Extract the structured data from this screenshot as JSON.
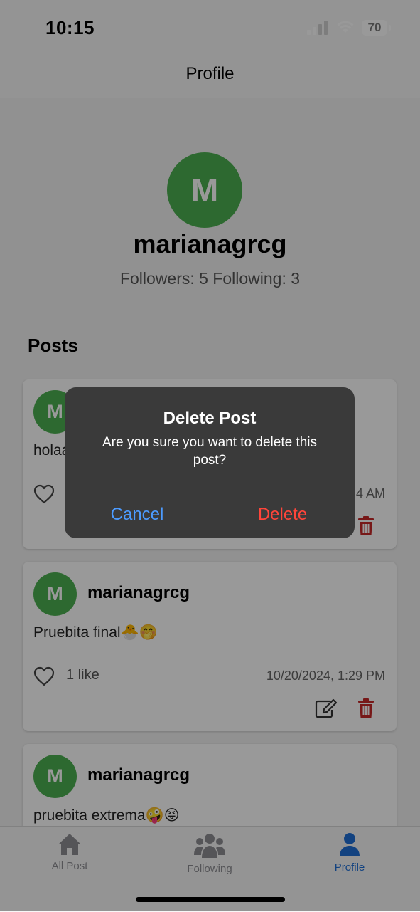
{
  "status_bar": {
    "time": "10:15",
    "battery": "70"
  },
  "header": {
    "title": "Profile"
  },
  "profile": {
    "avatar_initial": "M",
    "username": "marianagrcg",
    "stats": "Followers: 5 Following: 3",
    "posts_heading": "Posts"
  },
  "posts": [
    {
      "avatar_initial": "M",
      "username": "",
      "text": "holaa",
      "likes": "",
      "date": "4 AM"
    },
    {
      "avatar_initial": "M",
      "username": "marianagrcg",
      "text": "Pruebita final🐣🤭",
      "likes": "1 like",
      "date": "10/20/2024, 1:29 PM"
    },
    {
      "avatar_initial": "M",
      "username": "marianagrcg",
      "text": "pruebita extrema🤪😝"
    }
  ],
  "tabs": [
    {
      "label": "All Post",
      "icon": "home-icon"
    },
    {
      "label": "Following",
      "icon": "users-icon"
    },
    {
      "label": "Profile",
      "icon": "user-icon",
      "active": true
    }
  ],
  "alert": {
    "title": "Delete Post",
    "message": "Are you sure you want to delete this post?",
    "cancel_label": "Cancel",
    "delete_label": "Delete"
  },
  "colors": {
    "avatar": "#4caf50",
    "delete_red": "#c62828",
    "active_tab": "#1f6fd6",
    "alert_cancel": "#4c9bff",
    "alert_delete": "#ff453a"
  }
}
